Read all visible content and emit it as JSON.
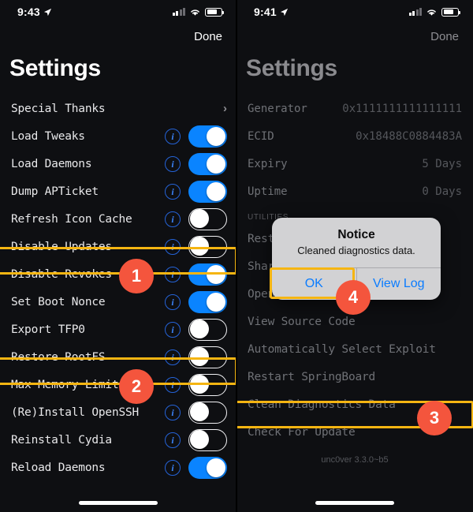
{
  "left": {
    "status": {
      "time": "9:43",
      "location_icon": "location-arrow-icon",
      "signal_icon": "cellular-signal-icon",
      "wifi_icon": "wifi-icon",
      "battery_icon": "battery-icon"
    },
    "nav": {
      "done_label": "Done"
    },
    "title": "Settings",
    "rows": [
      {
        "label": "Special Thanks",
        "accessory": "chevron",
        "info": false,
        "toggle": null
      },
      {
        "label": "Load Tweaks",
        "accessory": "toggle",
        "info": true,
        "toggle": "on"
      },
      {
        "label": "Load Daemons",
        "accessory": "toggle",
        "info": true,
        "toggle": "on"
      },
      {
        "label": "Dump APTicket",
        "accessory": "toggle",
        "info": true,
        "toggle": "on"
      },
      {
        "label": "Refresh Icon Cache",
        "accessory": "toggle",
        "info": true,
        "toggle": "off"
      },
      {
        "label": "Disable Updates",
        "accessory": "toggle",
        "info": true,
        "toggle": "off"
      },
      {
        "label": "Disable Revokes",
        "accessory": "toggle",
        "info": true,
        "toggle": "on"
      },
      {
        "label": "Set Boot Nonce",
        "accessory": "toggle",
        "info": true,
        "toggle": "on"
      },
      {
        "label": "Export TFP0",
        "accessory": "toggle",
        "info": true,
        "toggle": "off"
      },
      {
        "label": "Restore RootFS",
        "accessory": "toggle",
        "info": true,
        "toggle": "off"
      },
      {
        "label": "Max Memory Limit",
        "accessory": "toggle",
        "info": true,
        "toggle": "off"
      },
      {
        "label": "(Re)Install OpenSSH",
        "accessory": "toggle",
        "info": true,
        "toggle": "off"
      },
      {
        "label": "Reinstall Cydia",
        "accessory": "toggle",
        "info": true,
        "toggle": "off"
      },
      {
        "label": "Reload Daemons",
        "accessory": "toggle",
        "info": true,
        "toggle": "on"
      }
    ]
  },
  "right": {
    "status": {
      "time": "9:41",
      "location_icon": "location-arrow-icon",
      "signal_icon": "cellular-signal-icon",
      "wifi_icon": "wifi-icon",
      "battery_icon": "battery-icon"
    },
    "nav": {
      "done_label": "Done"
    },
    "title": "Settings",
    "info_rows": [
      {
        "key": "Generator",
        "value": "0x1111111111111111"
      },
      {
        "key": "ECID",
        "value": "0x18488C0884483A"
      },
      {
        "key": "Expiry",
        "value": "5 Days"
      },
      {
        "key": "Uptime",
        "value": "0 Days"
      }
    ],
    "section_header": "UTILITIES",
    "action_rows": [
      {
        "label": "Restore RootFS"
      },
      {
        "label": "Share Log"
      },
      {
        "label": "Open Cydia"
      },
      {
        "label": "View Source Code"
      },
      {
        "label": "Automatically Select Exploit"
      },
      {
        "label": "Restart SpringBoard"
      },
      {
        "label": "Clean Diagnostics Data"
      },
      {
        "label": "Check For Update"
      }
    ],
    "version": "unc0ver 3.3.0~b5"
  },
  "alert": {
    "title": "Notice",
    "message": "Cleaned diagnostics data.",
    "ok_label": "OK",
    "view_log_label": "View Log"
  },
  "annotations": {
    "badges": [
      {
        "number": "1",
        "target": "disable-updates-row"
      },
      {
        "number": "2",
        "target": "restore-rootfs-row"
      },
      {
        "number": "3",
        "target": "clean-diagnostics-data-row"
      },
      {
        "number": "4",
        "target": "alert-ok-button"
      }
    ],
    "highlight_color": "#f5b512",
    "badge_color": "#f4553d"
  }
}
